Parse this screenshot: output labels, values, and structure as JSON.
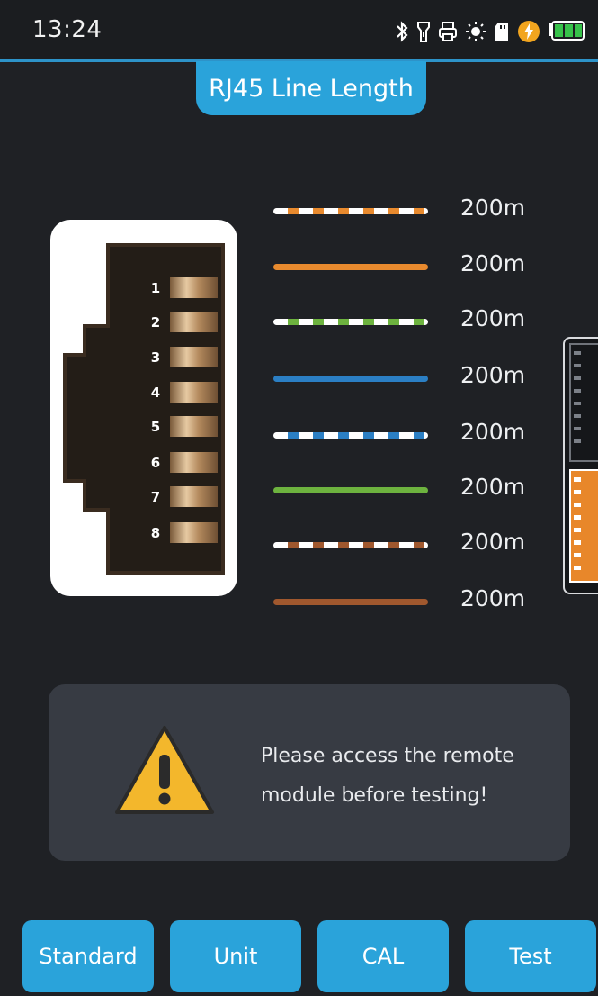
{
  "status_bar": {
    "time": "13:24",
    "icons": [
      "bluetooth-icon",
      "flashlight-icon",
      "printer-icon",
      "brightness-icon",
      "sd-card-icon",
      "charging-icon",
      "battery-icon"
    ]
  },
  "screen": {
    "title": "RJ45 Line Length"
  },
  "connector": {
    "pins": [
      "1",
      "2",
      "3",
      "4",
      "5",
      "6",
      "7",
      "8"
    ]
  },
  "wires": [
    {
      "length": "200m",
      "color": "#e88a2e",
      "striped": true
    },
    {
      "length": "200m",
      "color": "#e88a2e",
      "striped": false
    },
    {
      "length": "200m",
      "color": "#6db33f",
      "striped": true
    },
    {
      "length": "200m",
      "color": "#2b7fc4",
      "striped": false
    },
    {
      "length": "200m",
      "color": "#2b7fc4",
      "striped": true
    },
    {
      "length": "200m",
      "color": "#6db33f",
      "striped": false
    },
    {
      "length": "200m",
      "color": "#a0582e",
      "striped": true
    },
    {
      "length": "200m",
      "color": "#a0582e",
      "striped": false
    }
  ],
  "alert": {
    "icon": "warning-icon",
    "line1": "Please access the remote",
    "line2": "module before testing!"
  },
  "buttons": {
    "standard": "Standard",
    "unit": "Unit",
    "cal": "CAL",
    "test": "Test"
  },
  "colors": {
    "accent": "#2aa3da",
    "background": "#1f2125",
    "alert_bg": "#373b43",
    "warning": "#f3b72c"
  }
}
